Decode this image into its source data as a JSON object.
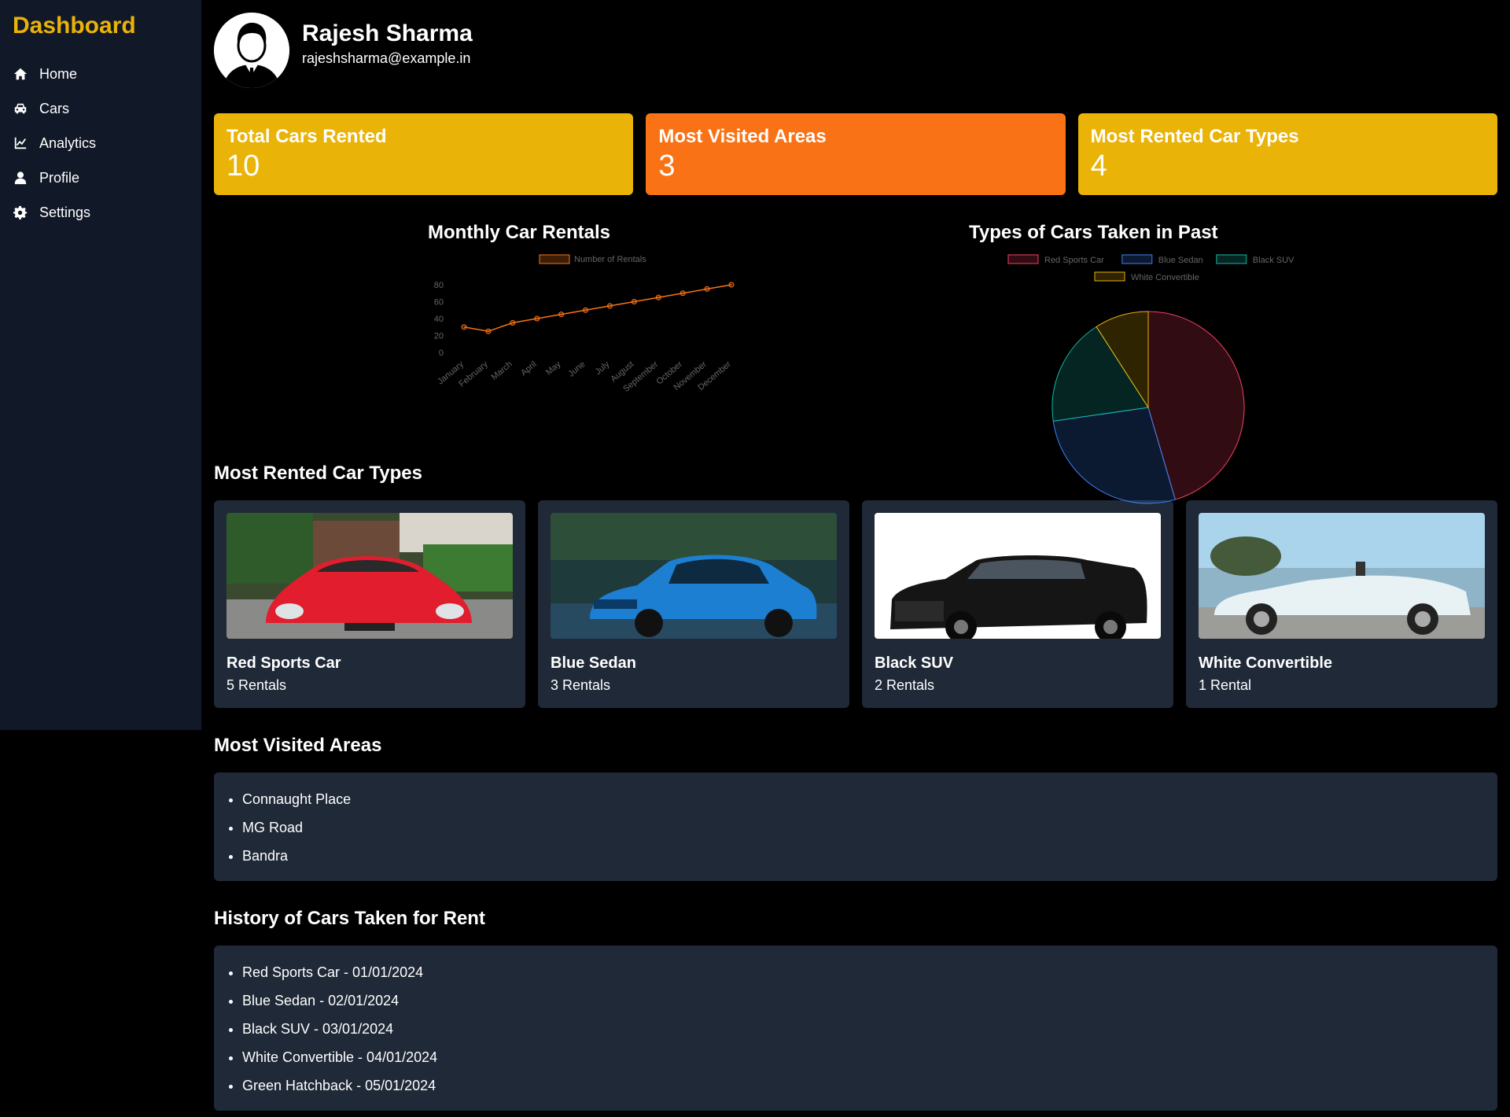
{
  "sidebar": {
    "title": "Dashboard",
    "items": [
      {
        "label": "Home",
        "icon": "home-icon"
      },
      {
        "label": "Cars",
        "icon": "car-icon"
      },
      {
        "label": "Analytics",
        "icon": "chart-line-icon"
      },
      {
        "label": "Profile",
        "icon": "user-icon"
      },
      {
        "label": "Settings",
        "icon": "gear-icon"
      }
    ]
  },
  "profile": {
    "name": "Rajesh Sharma",
    "email": "rajeshsharma@example.in"
  },
  "stats": [
    {
      "title": "Total Cars Rented",
      "value": "10",
      "color": "#eab308"
    },
    {
      "title": "Most Visited Areas",
      "value": "3",
      "color": "#f97316"
    },
    {
      "title": "Most Rented Car Types",
      "value": "4",
      "color": "#eab308"
    }
  ],
  "chart_data": [
    {
      "type": "line",
      "title": "Monthly Car Rentals",
      "x": [
        "January",
        "February",
        "March",
        "April",
        "May",
        "June",
        "July",
        "August",
        "September",
        "October",
        "November",
        "December"
      ],
      "series": [
        {
          "name": "Number of Rentals",
          "values": [
            30,
            25,
            35,
            40,
            45,
            50,
            55,
            60,
            65,
            70,
            75,
            80
          ],
          "color": "#f97316"
        }
      ],
      "ylim": [
        0,
        80
      ],
      "yticks": [
        0,
        20,
        40,
        60,
        80
      ],
      "legend": "top"
    },
    {
      "type": "pie",
      "title": "Types of Cars Taken in Past",
      "categories": [
        "Red Sports Car",
        "Blue Sedan",
        "Black SUV",
        "White Convertible"
      ],
      "values": [
        5,
        3,
        2,
        1
      ],
      "colors": [
        "#f43f5e",
        "#3b82f6",
        "#14b8a6",
        "#eab308"
      ],
      "legend": "top"
    }
  ],
  "car_types": {
    "heading": "Most Rented Car Types",
    "items": [
      {
        "name": "Red Sports Car",
        "rentals": "5 Rentals"
      },
      {
        "name": "Blue Sedan",
        "rentals": "3 Rentals"
      },
      {
        "name": "Black SUV",
        "rentals": "2 Rentals"
      },
      {
        "name": "White Convertible",
        "rentals": "1 Rental"
      }
    ]
  },
  "areas": {
    "heading": "Most Visited Areas",
    "items": [
      "Connaught Place",
      "MG Road",
      "Bandra"
    ]
  },
  "history": {
    "heading": "History of Cars Taken for Rent",
    "items": [
      "Red Sports Car - 01/01/2024",
      "Blue Sedan - 02/01/2024",
      "Black SUV - 03/01/2024",
      "White Convertible - 04/01/2024",
      "Green Hatchback - 05/01/2024"
    ]
  }
}
